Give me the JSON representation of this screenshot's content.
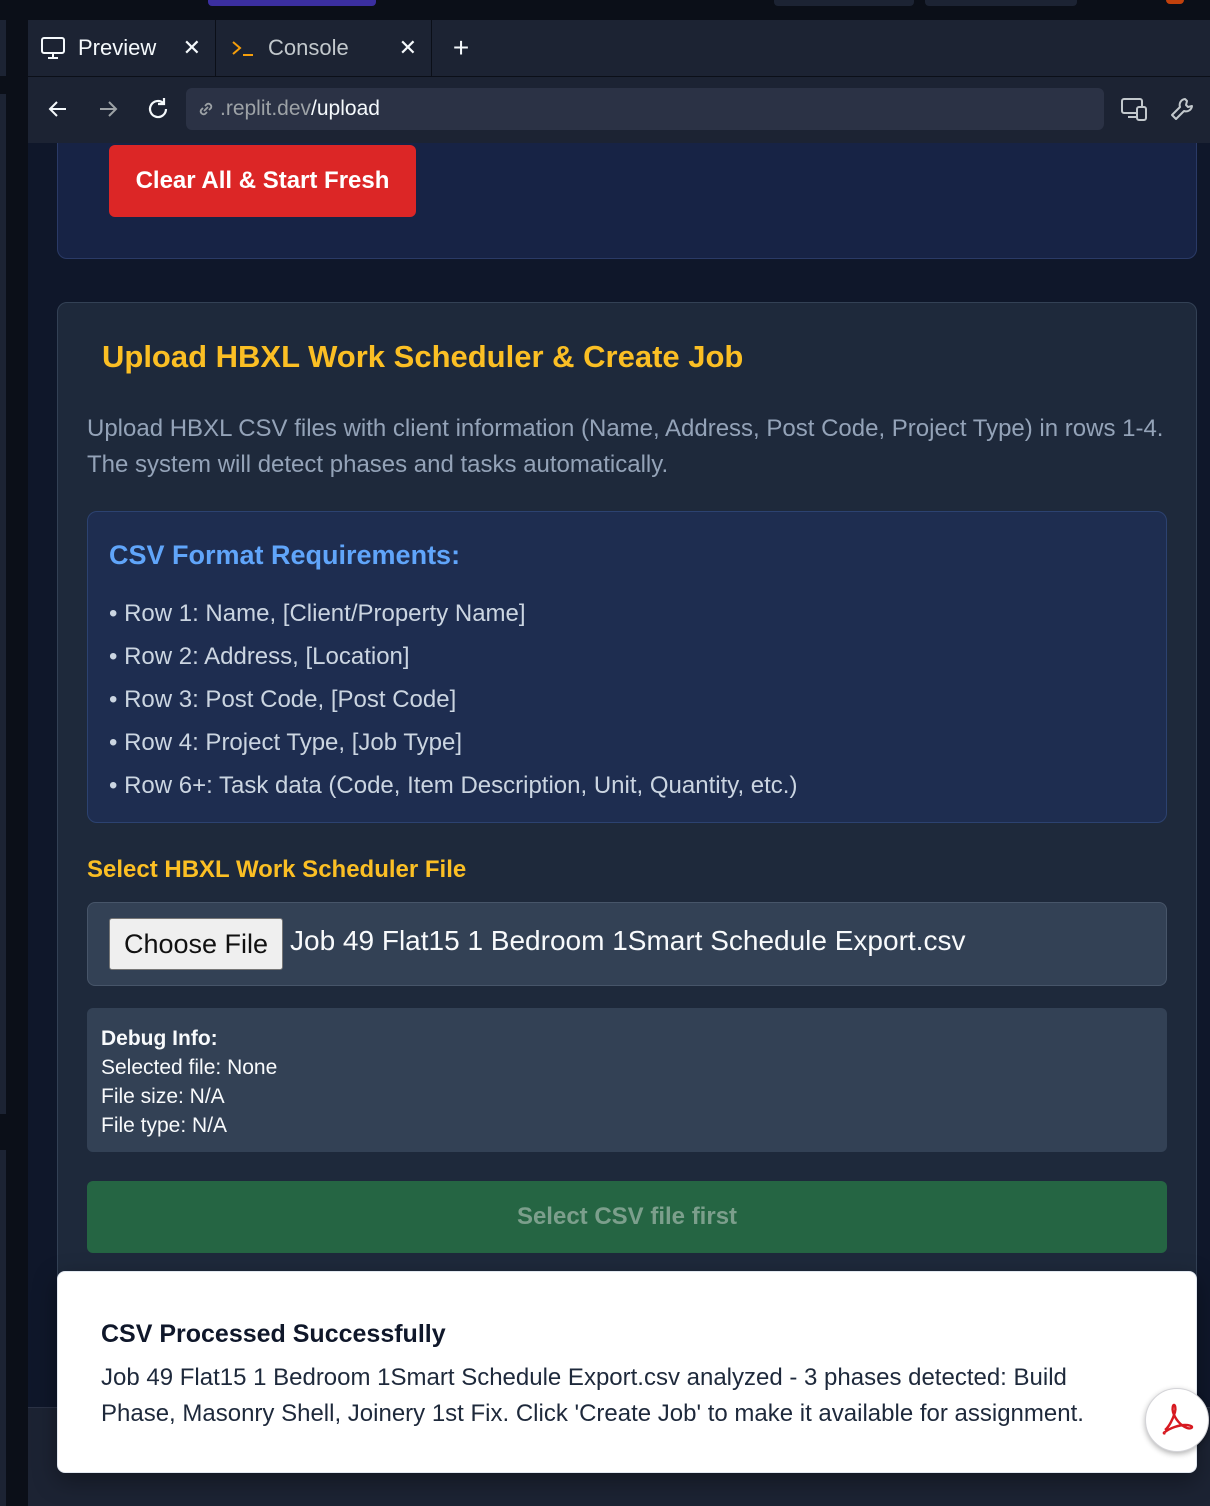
{
  "browser": {
    "tabs": [
      {
        "label": "Preview",
        "icon": "monitor-icon"
      },
      {
        "label": "Console",
        "icon": "terminal-icon"
      }
    ],
    "new_tab_symbol": "+",
    "url_host": ".replit.dev",
    "url_path": "/upload"
  },
  "top_card": {
    "clear_button": "Clear All & Start Fresh"
  },
  "upload": {
    "title": "Upload HBXL Work Scheduler & Create Job",
    "description": "Upload HBXL CSV files with client information (Name, Address, Post Code, Project Type) in rows 1-4. The system will detect phases and tasks automatically.",
    "requirements_title": "CSV Format Requirements:",
    "requirements": [
      "• Row 1: Name, [Client/Property Name]",
      "• Row 2: Address, [Location]",
      "• Row 3: Post Code, [Post Code]",
      "• Row 4: Project Type, [Job Type]",
      "• Row 6+: Task data (Code, Item Description, Unit, Quantity, etc.)"
    ],
    "file_label": "Select HBXL Work Scheduler File",
    "choose_file_label": "Choose File",
    "selected_file_name": "Job 49 Flat15 1 Bedroom 1Smart Schedule Export.csv",
    "debug": {
      "heading": "Debug Info:",
      "selected_file": "Selected file: None",
      "file_size": "File size: N/A",
      "file_type": "File type: N/A"
    },
    "submit_label": "Select CSV file first"
  },
  "toast": {
    "title": "CSV Processed Successfully",
    "message": "Job 49 Flat15 1 Bedroom 1Smart Schedule Export.csv analyzed - 3 phases detected: Build Phase, Masonry Shell, Joinery 1st Fix. Click 'Create Job' to make it available for assignment."
  },
  "colors": {
    "accent_yellow": "#fbbf24",
    "danger_red": "#dc2626",
    "heading_blue": "#60a5fa",
    "disabled_green": "#256543"
  }
}
